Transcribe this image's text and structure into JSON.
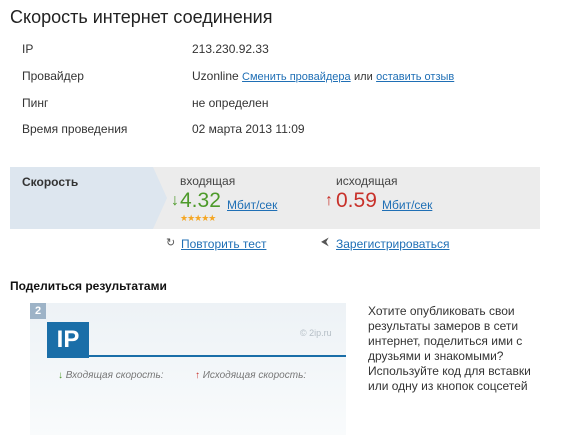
{
  "page": {
    "title": "Скорость интернет соединения"
  },
  "info": {
    "ip": {
      "label": "IP",
      "value": "213.230.92.33"
    },
    "provider": {
      "label": "Провайдер",
      "value": "Uzonline",
      "change_link": "Сменить провайдера",
      "or_text": "или",
      "review_link": "оставить отзыв"
    },
    "ping": {
      "label": "Пинг",
      "value": "не определен"
    },
    "time": {
      "label": "Время проведения",
      "value": "02 марта 2013 11:09"
    }
  },
  "speed": {
    "label": "Скорость",
    "incoming": {
      "title": "входящая",
      "arrow": "↓",
      "value": "4.32",
      "unit": "Мбит/сек",
      "stars": "★★★★★",
      "rating": 5
    },
    "outgoing": {
      "title": "исходящая",
      "arrow": "↑",
      "value": "0.59",
      "unit": "Мбит/сек"
    }
  },
  "actions": {
    "repeat": {
      "icon": "refresh-icon",
      "label": "Повторить тест"
    },
    "register": {
      "icon": "plug-icon",
      "label": "Зарегистрироваться"
    }
  },
  "share": {
    "title": "Поделиться результатами",
    "widget": {
      "badge": "2",
      "logo": "IP",
      "site": "© 2ip.ru",
      "incoming_arrow": "↓",
      "incoming_label": "Входящая скорость:",
      "outgoing_arrow": "↑",
      "outgoing_label": "Исходящая скорость:"
    },
    "text": "Хотите опубликовать свои результаты замеров в сети интернет, поделиться ими с друзьями и знакомыми? Используйте код для вставки или одну из кнопок соцсетей"
  },
  "colors": {
    "accent_link": "#1f6fb5",
    "download": "#4d9a2a",
    "upload": "#c8312a",
    "logo": "#1a6ea8"
  }
}
